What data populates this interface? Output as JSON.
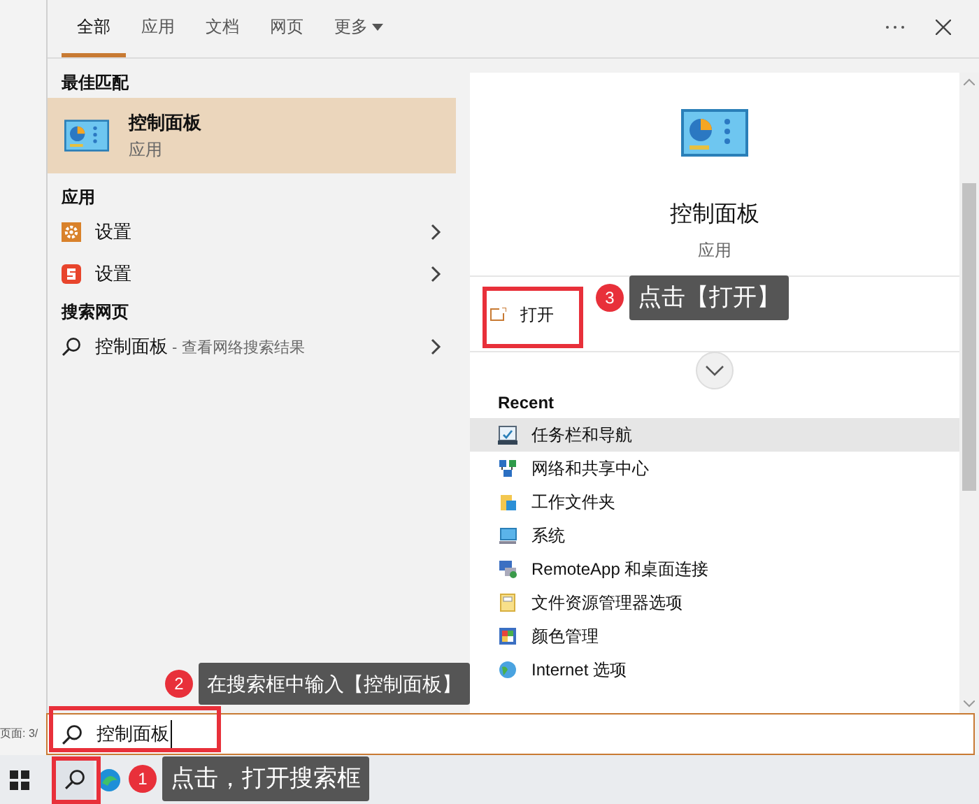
{
  "background_document": {
    "page_indicator": "页面: 3/"
  },
  "tabs": [
    {
      "label": "全部",
      "selected": true,
      "has_menu": false
    },
    {
      "label": "应用",
      "selected": false,
      "has_menu": false
    },
    {
      "label": "文档",
      "selected": false,
      "has_menu": false
    },
    {
      "label": "网页",
      "selected": false,
      "has_menu": false
    },
    {
      "label": "更多",
      "selected": false,
      "has_menu": true
    }
  ],
  "best_match": {
    "heading": "最佳匹配",
    "item": {
      "title": "控制面板",
      "subtitle": "应用",
      "selected": true
    }
  },
  "apps": {
    "heading": "应用",
    "items": [
      {
        "label": "设置",
        "kind": "gear"
      },
      {
        "label": "设置",
        "kind": "sogou"
      }
    ]
  },
  "web": {
    "heading": "搜索网页",
    "item": {
      "label": "控制面板",
      "suffix": " - 查看网络搜索结果"
    }
  },
  "detail": {
    "title": "控制面板",
    "subtitle": "应用",
    "actions": [
      {
        "label": "打开"
      }
    ],
    "recent_heading": "Recent",
    "recent": [
      {
        "label": "任务栏和导航",
        "kind": "taskbar",
        "selected": true
      },
      {
        "label": "网络和共享中心",
        "kind": "network",
        "selected": false
      },
      {
        "label": "工作文件夹",
        "kind": "folder",
        "selected": false
      },
      {
        "label": "系统",
        "kind": "system",
        "selected": false
      },
      {
        "label": "RemoteApp 和桌面连接",
        "kind": "remote",
        "selected": false
      },
      {
        "label": "文件资源管理器选项",
        "kind": "explorer",
        "selected": false
      },
      {
        "label": "颜色管理",
        "kind": "color",
        "selected": false
      },
      {
        "label": "Internet 选项",
        "kind": "internet",
        "selected": false
      }
    ]
  },
  "search": {
    "value": "控制面板"
  },
  "annotations": [
    {
      "number": "3",
      "text": "点击【打开】"
    },
    {
      "number": "2",
      "text": "在搜索框中输入【控制面板】"
    },
    {
      "number": "1",
      "text": "点击，打开搜索框"
    }
  ]
}
